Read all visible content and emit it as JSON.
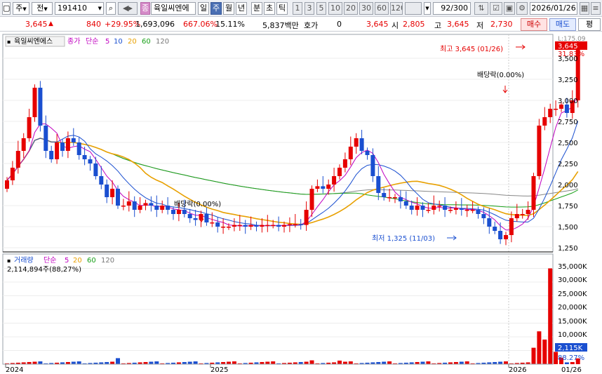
{
  "toolbar": {
    "market": "주",
    "prefix": "전",
    "code": "191410",
    "name": "육일씨엔에",
    "badge": "종",
    "periods": [
      "일",
      "주",
      "월",
      "년",
      "분",
      "초",
      "틱"
    ],
    "active_period": "주",
    "ticks": [
      "1",
      "3",
      "5",
      "10",
      "20",
      "30",
      "60",
      "120"
    ],
    "count": "92/300",
    "date": "2026/01/26",
    "arrow_down": "▼",
    "chevron": "▼"
  },
  "quote": {
    "price": "3,645",
    "up": "▲",
    "change": "840",
    "pct": "+29.95%",
    "volume": "1,693,096",
    "vol_pct": "667.06%",
    "turnover": "15.11%",
    "amount": "5,837백만",
    "hoga_label": "호가",
    "hoga_val": "0",
    "hoga_price": "3,645",
    "open_label": "시",
    "open": "2,805",
    "high_label": "고",
    "high": "3,645",
    "low_label": "저",
    "low": "2,730",
    "buy": "매수",
    "sell": "매도",
    "extra": "평"
  },
  "price_panel": {
    "stock": "육일씨엔에스",
    "legend": [
      "종가",
      "단순",
      "5",
      "10",
      "20",
      "60",
      "120"
    ],
    "high_note": "최고 3,645 (01/26)",
    "low_note": "최저 1,325 (11/03)",
    "div1": "배당락(0.00%)",
    "div2": "배당락(0.00%)",
    "axis": [
      "3,500",
      "3,250",
      "3,000",
      "2,750",
      "2,500",
      "2,250",
      "2,000",
      "1,750",
      "1,500",
      "1,250"
    ],
    "price_tag": "3,645",
    "pct_tag": "31.83%",
    "limit_tag": "L:175.09"
  },
  "vol_panel": {
    "legend": [
      "거래량",
      "단순",
      "5",
      "20",
      "60",
      "120"
    ],
    "stat": "2,114,894주(88,27%)",
    "axis": [
      "35,000K",
      "30,000K",
      "25,000K",
      "20,000K",
      "15,000K",
      "10,000K",
      "5,000K"
    ],
    "vol_tag": "2,115K",
    "vol_pct_tag": "88.27%"
  },
  "xaxis": {
    "labels": [
      "2024",
      "2025",
      "2026"
    ],
    "last": "01/26"
  },
  "colors": {
    "up": "#e60000",
    "down": "#1a4fd0",
    "ma5": "#c000c0",
    "ma10": "#1a4fd0",
    "ma20": "#e8a000",
    "ma60": "#18a018",
    "ma120": "#888888"
  },
  "chart_data": {
    "type": "candlestick",
    "period": "weekly",
    "x": [
      "2024",
      "2025",
      "2026"
    ],
    "close_last": 3645,
    "high": 3645,
    "low": 1325,
    "ylim": [
      1200,
      3750
    ],
    "volume_last_k": 2115,
    "volume_ylim_k": [
      0,
      37000
    ]
  }
}
